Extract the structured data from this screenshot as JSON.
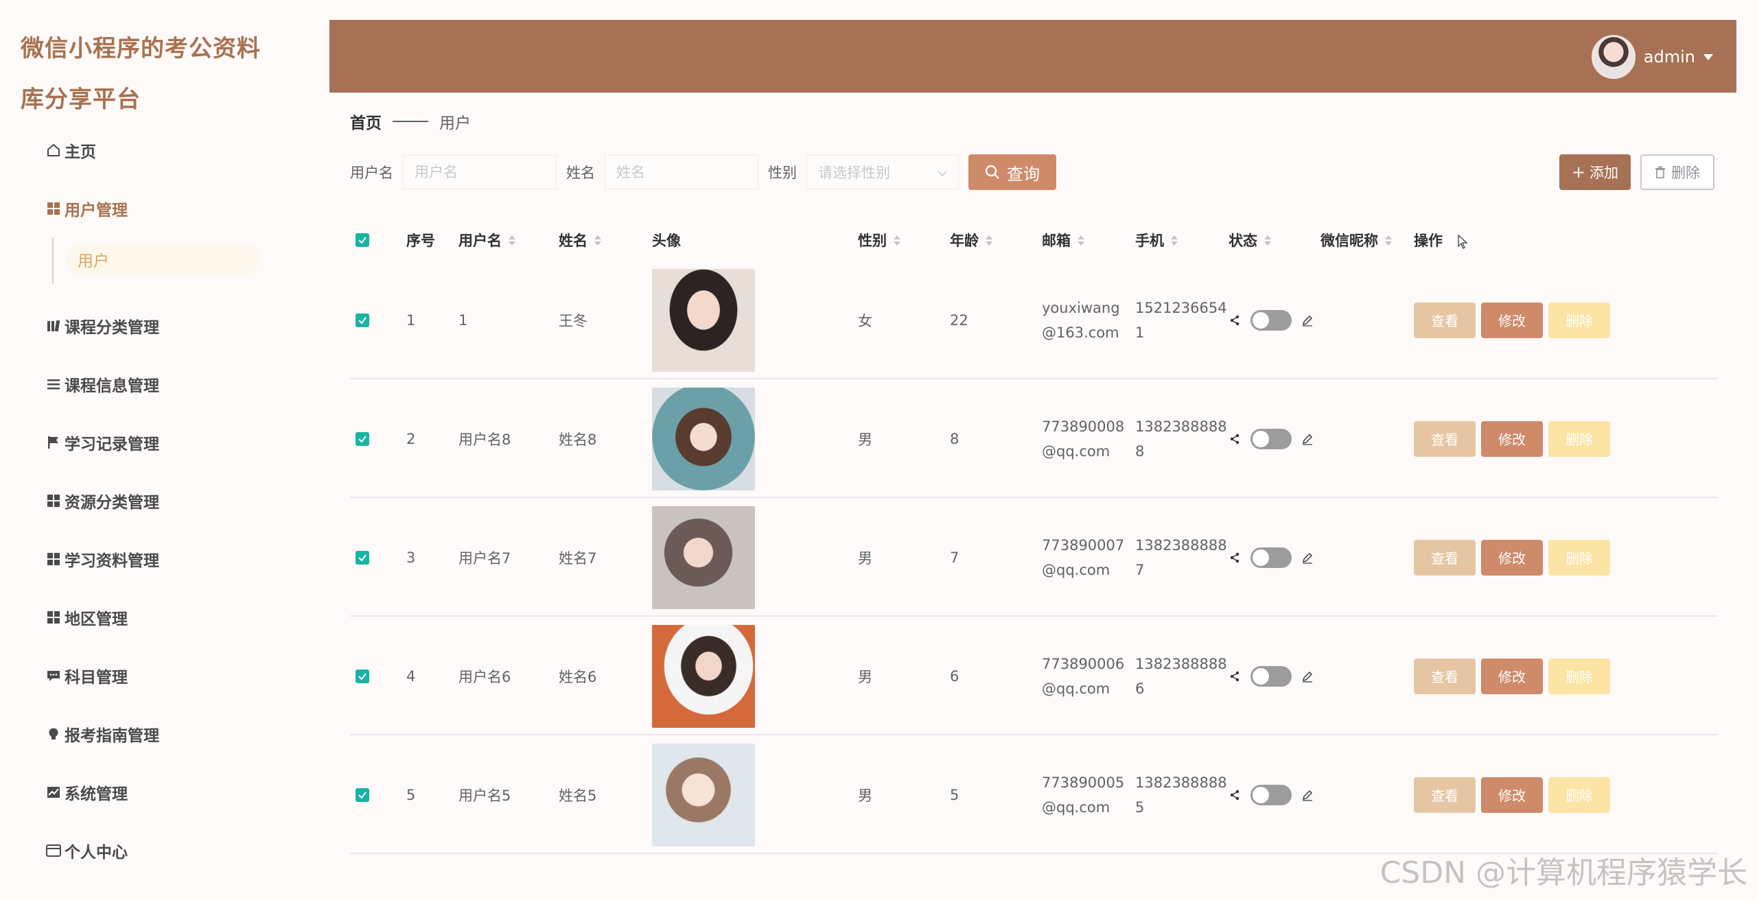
{
  "brand": {
    "title": "微信小程序的考公资料库分享平台"
  },
  "header": {
    "user_name": "admin"
  },
  "sidebar": {
    "items": [
      {
        "label": "主页",
        "icon": "home-icon"
      },
      {
        "label": "用户管理",
        "icon": "grid-icon",
        "active": true
      },
      {
        "label": "课程分类管理",
        "icon": "books-icon"
      },
      {
        "label": "课程信息管理",
        "icon": "list-icon"
      },
      {
        "label": "学习记录管理",
        "icon": "flag-icon"
      },
      {
        "label": "资源分类管理",
        "icon": "grid-icon"
      },
      {
        "label": "学习资料管理",
        "icon": "grid-icon"
      },
      {
        "label": "地区管理",
        "icon": "grid-icon"
      },
      {
        "label": "科目管理",
        "icon": "chat-icon"
      },
      {
        "label": "报考指南管理",
        "icon": "bulb-icon"
      },
      {
        "label": "系统管理",
        "icon": "chart-icon"
      },
      {
        "label": "个人中心",
        "icon": "card-icon"
      }
    ],
    "sub_item": "用户"
  },
  "breadcrumb": {
    "home": "首页",
    "current": "用户"
  },
  "search": {
    "username_label": "用户名",
    "username_placeholder": "用户名",
    "name_label": "姓名",
    "name_placeholder": "姓名",
    "gender_label": "性别",
    "gender_placeholder": "请选择性别",
    "query_button": "查询"
  },
  "actions": {
    "add": "添加",
    "delete": "删除"
  },
  "table": {
    "columns": {
      "index": "序号",
      "username": "用户名",
      "name": "姓名",
      "avatar": "头像",
      "gender": "性别",
      "age": "年龄",
      "email": "邮箱",
      "phone": "手机",
      "status": "状态",
      "wechat": "微信昵称",
      "ops": "操作"
    },
    "op_labels": {
      "view": "查看",
      "edit": "修改",
      "delete": "删除"
    },
    "rows": [
      {
        "index": "1",
        "username": "1",
        "name": "王冬",
        "gender": "女",
        "age": "22",
        "email_l1": "youxiwang",
        "email_l2": "@163.com",
        "phone_l1": "1521236654",
        "phone_l2": "1"
      },
      {
        "index": "2",
        "username": "用户名8",
        "name": "姓名8",
        "gender": "男",
        "age": "8",
        "email_l1": "773890008",
        "email_l2": "@qq.com",
        "phone_l1": "1382388888",
        "phone_l2": "8"
      },
      {
        "index": "3",
        "username": "用户名7",
        "name": "姓名7",
        "gender": "男",
        "age": "7",
        "email_l1": "773890007",
        "email_l2": "@qq.com",
        "phone_l1": "1382388888",
        "phone_l2": "7"
      },
      {
        "index": "4",
        "username": "用户名6",
        "name": "姓名6",
        "gender": "男",
        "age": "6",
        "email_l1": "773890006",
        "email_l2": "@qq.com",
        "phone_l1": "1382388888",
        "phone_l2": "6"
      },
      {
        "index": "5",
        "username": "用户名5",
        "name": "姓名5",
        "gender": "男",
        "age": "5",
        "email_l1": "773890005",
        "email_l2": "@qq.com",
        "phone_l1": "1382388888",
        "phone_l2": "5"
      }
    ]
  },
  "watermark": "CSDN @计算机程序猿学长",
  "colors": {
    "accent": "#a77155",
    "brand_text": "#a8714f",
    "button_query": "#cf8a6a",
    "checkbox": "#17b3a3",
    "op_view": "#e6c6a2",
    "op_delete": "#fbe4a4"
  }
}
